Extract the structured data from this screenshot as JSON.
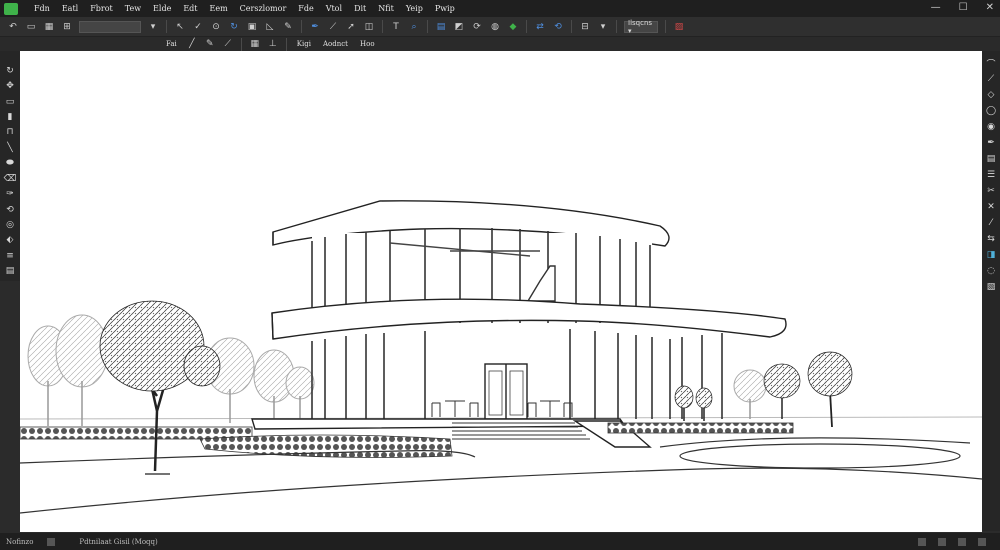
{
  "menubar": {
    "items": [
      "Fdn",
      "Eatl",
      "Fbrot",
      "Tew",
      "Elde",
      "Edt",
      "Eem",
      "Cerszlomor",
      "Fde",
      "Vtol",
      "Dit",
      "Nfit",
      "Yeip",
      "Pwip"
    ]
  },
  "window_controls": {
    "minimize": "—",
    "maximize": "☐",
    "close": "✕"
  },
  "toolbar1": {
    "layer_combo": "",
    "zoom_combo": "Ilsqcns ▾"
  },
  "toolbar2": {
    "label_a": "Fai",
    "label_b": "Kigi",
    "label_c": "Aodnct",
    "label_d": "Hoo"
  },
  "statusbar": {
    "left": "Nofinzo",
    "middle": "Pdtnilaat Gisil (Moqq)"
  },
  "icons": {
    "app": "app-logo-icon",
    "accent_green": "#3fb24a",
    "accent_blue": "#4f8fe0",
    "accent_red": "#d04848"
  }
}
